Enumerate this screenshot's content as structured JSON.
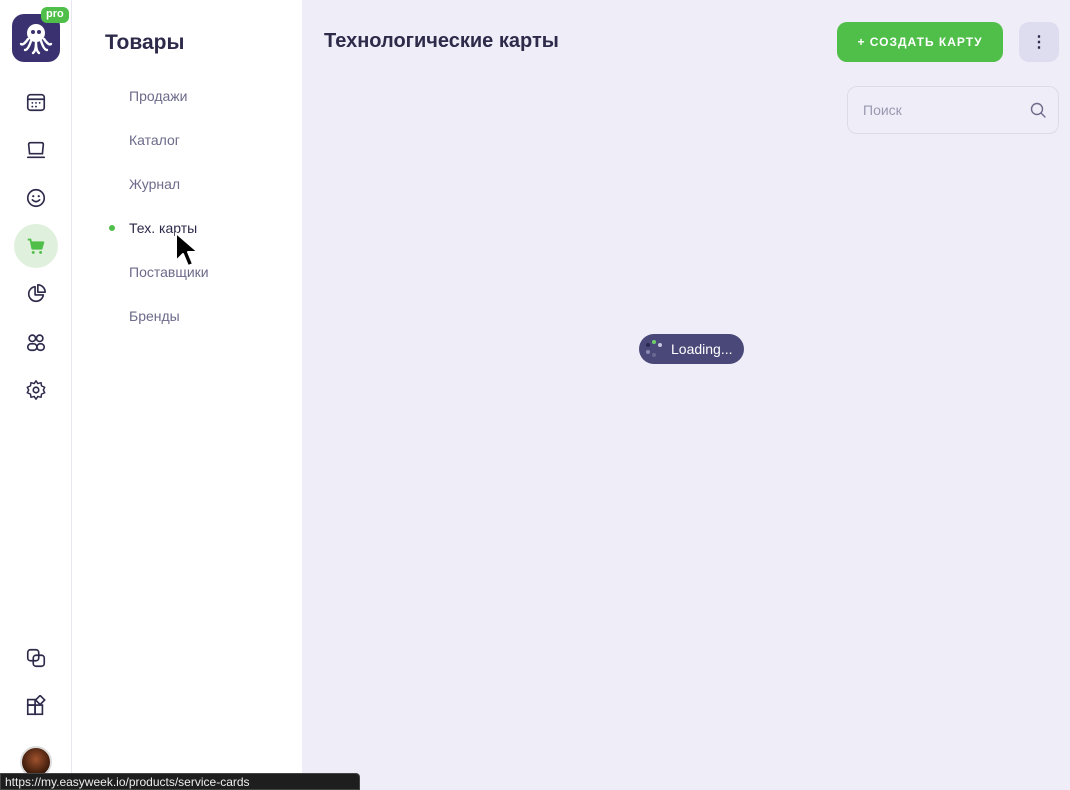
{
  "app": {
    "logo_badge": "pro",
    "brand_color": "#4fbf4a",
    "logo_bg": "#3a3270"
  },
  "rail": {
    "icons": [
      {
        "name": "calendar-icon",
        "active": false
      },
      {
        "name": "monitor-icon",
        "active": false
      },
      {
        "name": "smiley-icon",
        "active": false
      },
      {
        "name": "cart-icon",
        "active": true
      },
      {
        "name": "pie-chart-icon",
        "active": false
      },
      {
        "name": "users-icon",
        "active": false
      },
      {
        "name": "gear-icon",
        "active": false
      },
      {
        "name": "copy-icon",
        "active": false
      },
      {
        "name": "apps-icon",
        "active": false
      }
    ]
  },
  "subnav": {
    "title": "Товары",
    "items": [
      {
        "label": "Продажи",
        "active": false
      },
      {
        "label": "Каталог",
        "active": false
      },
      {
        "label": "Журнал",
        "active": false
      },
      {
        "label": "Тех. карты",
        "active": true
      },
      {
        "label": "Поставщики",
        "active": false
      },
      {
        "label": "Бренды",
        "active": false
      }
    ]
  },
  "main": {
    "title": "Технологические карты",
    "create_button": "+ СОЗДАТЬ КАРТУ",
    "more_button": "⋮",
    "search": {
      "placeholder": "Поиск",
      "value": ""
    },
    "loading": "Loading..."
  },
  "statusbar": {
    "url": "https://my.easyweek.io/products/service-cards"
  }
}
